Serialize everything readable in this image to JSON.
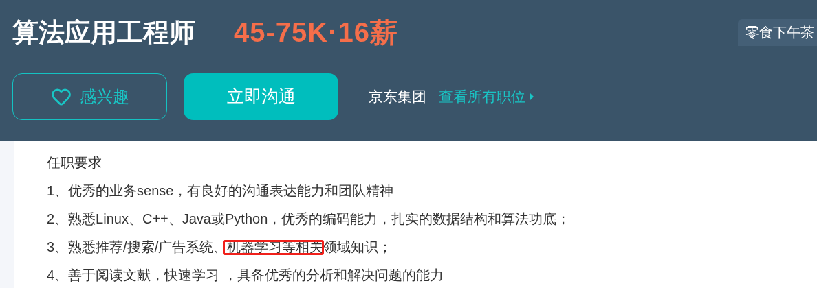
{
  "header": {
    "title": "算法应用工程师",
    "salary": "45-75K·16薪",
    "tag": "零食下午茶",
    "interest_button": "感兴趣",
    "chat_button": "立即沟通",
    "company": "京东集团",
    "all_jobs_link": "查看所有职位"
  },
  "requirements": {
    "heading": "任职要求",
    "lines": [
      {
        "parts": [
          {
            "text": "1、优秀的业务sense，有良好的沟通表达能力和团队精神",
            "highlighted": false
          }
        ]
      },
      {
        "parts": [
          {
            "text": "2、熟悉Linux、C++、Java或Python，优秀的编码能力，扎实的数据结构和算法功底；",
            "highlighted": false
          }
        ]
      },
      {
        "parts": [
          {
            "text": "3、熟悉推荐/搜索/广告系统、",
            "highlighted": false
          },
          {
            "text": "机器学习等相关",
            "highlighted": true
          },
          {
            "text": "领域知识；",
            "highlighted": false
          }
        ]
      },
      {
        "parts": [
          {
            "text": "4、善于阅读文献，快速学习 ，具备优秀的分析和解决问题的能力",
            "highlighted": false
          }
        ]
      }
    ]
  }
}
